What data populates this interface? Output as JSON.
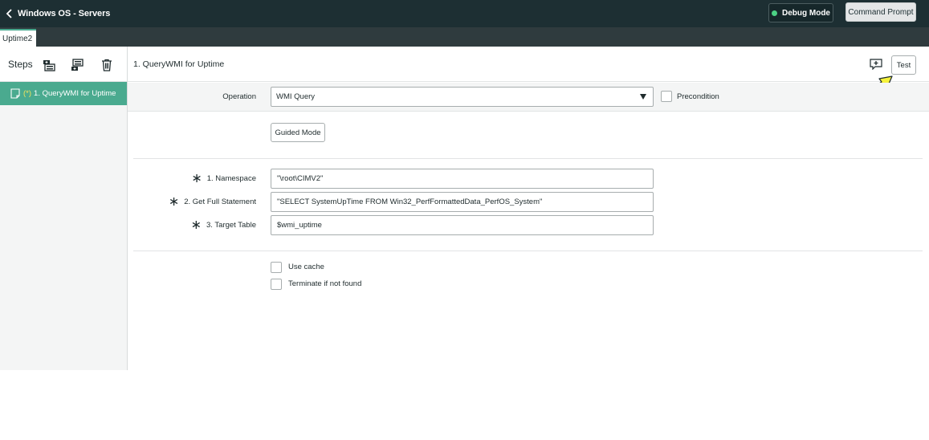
{
  "header": {
    "title": "Windows OS - Servers",
    "debug_label": "Debug Mode",
    "command_label": "Command Prompt",
    "debug_status_color": "#4bd184"
  },
  "tabs": [
    {
      "label": "Uptime2"
    }
  ],
  "sidebar": {
    "heading": "Steps",
    "tools": [
      "add-step-above-icon",
      "add-step-below-icon",
      "trash-icon"
    ],
    "items": [
      {
        "marker": "(*)",
        "label": "1.  QueryWMI for Uptime",
        "selected": true
      }
    ]
  },
  "step": {
    "title": "1. QueryWMI for Uptime",
    "test_label": "Test",
    "operation_label": "Operation",
    "operation_value": "WMI Query",
    "precondition_label": "Precondition",
    "guided_label": "Guided Mode",
    "params": [
      {
        "label": "1. Namespace",
        "value": "\"\\root\\CIMV2\""
      },
      {
        "label": "2. Get Full Statement",
        "value": "\"SELECT SystemUpTime FROM Win32_PerfFormattedData_PerfOS_System\""
      },
      {
        "label": "3. Target Table",
        "value": "$wmi_uptime"
      }
    ],
    "options": [
      {
        "label": "Use cache",
        "checked": false
      },
      {
        "label": "Terminate if not found",
        "checked": false
      }
    ]
  },
  "colors": {
    "header_bg": "#1d2f33",
    "accent": "#4aaa8f",
    "highlight_arrow": "#f5f23a"
  }
}
